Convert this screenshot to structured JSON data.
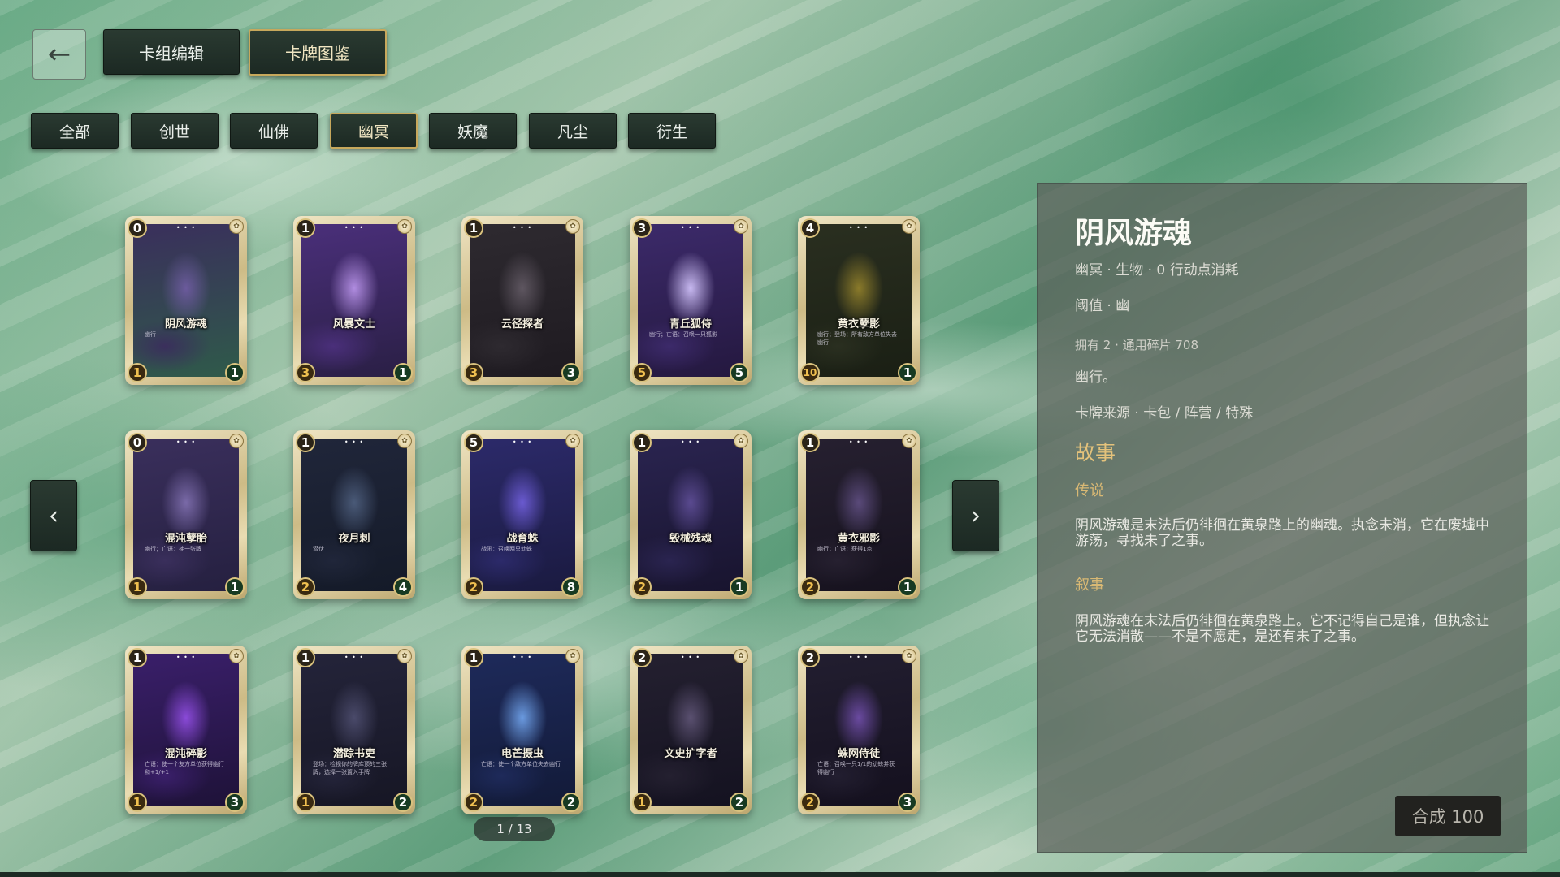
{
  "header": {
    "back_icon": "←",
    "tabs": [
      {
        "label": "卡组编辑",
        "active": false
      },
      {
        "label": "卡牌图鉴",
        "active": true
      }
    ]
  },
  "filters": [
    {
      "label": "全部",
      "active": false
    },
    {
      "label": "创世",
      "active": false
    },
    {
      "label": "仙佛",
      "active": false
    },
    {
      "label": "幽冥",
      "active": true
    },
    {
      "label": "妖魔",
      "active": false
    },
    {
      "label": "凡尘",
      "active": false
    },
    {
      "label": "衍生",
      "active": false
    }
  ],
  "nav": {
    "prev_icon": "‹",
    "next_icon": "›"
  },
  "cards": [
    {
      "name": "阴风游魂",
      "cost": "0",
      "atk": "1",
      "hp": "1",
      "desc": "幽行",
      "art": [
        "#3a2f5c",
        "#6b5a9c",
        "#2f5a4a"
      ]
    },
    {
      "name": "风暴文士",
      "cost": "1",
      "atk": "3",
      "hp": "1",
      "desc": "",
      "art": [
        "#4a2f7a",
        "#b08ce0",
        "#2a1f45"
      ]
    },
    {
      "name": "云径探者",
      "cost": "1",
      "atk": "3",
      "hp": "3",
      "desc": "",
      "art": [
        "#2e2a30",
        "#5e5660",
        "#1e1a20"
      ]
    },
    {
      "name": "青丘狐侍",
      "cost": "3",
      "atk": "5",
      "hp": "5",
      "desc": "幽行；亡语：召唤一只狐影",
      "art": [
        "#3c2a6a",
        "#c7b8f0",
        "#24183f"
      ]
    },
    {
      "name": "黄衣孽影",
      "cost": "4",
      "atk": "10",
      "hp": "1",
      "desc": "幽行；登场：所有敌方单位失去幽行",
      "art": [
        "#2a2f20",
        "#8a7a2a",
        "#1a1f14"
      ]
    },
    {
      "name": "混沌孽胎",
      "cost": "0",
      "atk": "1",
      "hp": "1",
      "desc": "幽行；亡语：抽一张牌",
      "art": [
        "#3a2f5c",
        "#7a6aa8",
        "#252040"
      ]
    },
    {
      "name": "夜月刺",
      "cost": "1",
      "atk": "2",
      "hp": "4",
      "desc": "潜伏",
      "art": [
        "#20263a",
        "#4a5a78",
        "#141a28"
      ]
    },
    {
      "name": "战育蛛",
      "cost": "5",
      "atk": "2",
      "hp": "8",
      "desc": "战吼：召唤两只幼蛛",
      "art": [
        "#2c2a6a",
        "#6a5ad0",
        "#1a1a40"
      ]
    },
    {
      "name": "毁械残魂",
      "cost": "1",
      "atk": "2",
      "hp": "1",
      "desc": "",
      "art": [
        "#2a2450",
        "#5a4a90",
        "#18142e"
      ]
    },
    {
      "name": "黄衣邪影",
      "cost": "1",
      "atk": "2",
      "hp": "1",
      "desc": "幽行；亡语：获得1点",
      "art": [
        "#262030",
        "#5a4a7a",
        "#16121e"
      ]
    },
    {
      "name": "混沌碎影",
      "cost": "1",
      "atk": "1",
      "hp": "3",
      "desc": "亡语：使一个友方单位获得幽行和+1/+1",
      "art": [
        "#3a1f6a",
        "#8a4ad8",
        "#1e1238"
      ]
    },
    {
      "name": "潜踪书吏",
      "cost": "1",
      "atk": "1",
      "hp": "2",
      "desc": "登场：检视你的牌库顶的三张牌，选择一张置入手牌",
      "art": [
        "#24243a",
        "#4a4a6a",
        "#161624"
      ]
    },
    {
      "name": "电芒摄虫",
      "cost": "1",
      "atk": "2",
      "hp": "2",
      "desc": "亡语：使一个敌方单位失去幽行",
      "art": [
        "#1e2a5a",
        "#6a9ae0",
        "#121a38"
      ]
    },
    {
      "name": "文史扩字者",
      "cost": "2",
      "atk": "1",
      "hp": "2",
      "desc": "",
      "art": [
        "#242030",
        "#5a5070",
        "#141220"
      ]
    },
    {
      "name": "蛛网侍徒",
      "cost": "2",
      "atk": "2",
      "hp": "3",
      "desc": "亡语：召唤一只1/1的幼蛛并获得幽行",
      "art": [
        "#221e30",
        "#6a4aa0",
        "#14101e"
      ]
    }
  ],
  "pager": "1 / 13",
  "detail": {
    "title": "阴风游魂",
    "meta": "幽冥 · 生物 · 0 行动点消耗",
    "threshold": "阈值 · 幽",
    "owned": "拥有 2 · 通用碎片 708",
    "keyword": "幽行。",
    "source": "卡牌来源 · 卡包 / 阵营 / 特殊",
    "story_heading": "故事",
    "legend_heading": "传说",
    "legend_text": "阴风游魂是末法后仍徘徊在黄泉路上的幽魂。执念未消，它在废墟中游荡，寻找未了之事。",
    "narrative_heading": "叙事",
    "narrative_text": "阴风游魂在末法后仍徘徊在黄泉路上。它不记得自己是谁，但执念让它无法消散——不是不愿走，是还有未了之事。",
    "craft_label": "合成 100"
  },
  "colors": {
    "accent_gold": "#c7a85c",
    "button_dark": "#1c2923",
    "story_gold": "#e4c27b"
  }
}
